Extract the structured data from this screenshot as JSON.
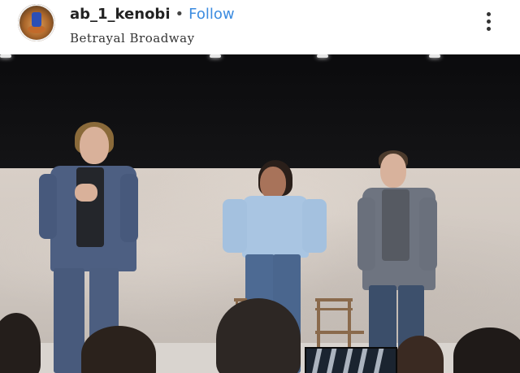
{
  "post": {
    "username": "ab_1_kenobi",
    "separator": "•",
    "follow_label": "Follow",
    "location": "Betrayal Broadway"
  },
  "icons": {
    "more": "more-options-icon",
    "avatar": "profile-avatar"
  },
  "colors": {
    "follow": "#3c8ce0",
    "text": "#222222"
  }
}
